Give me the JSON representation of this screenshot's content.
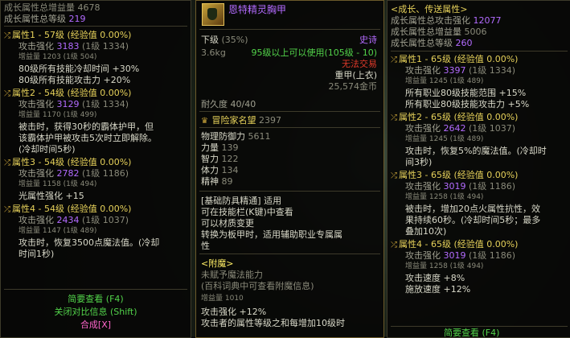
{
  "left": {
    "header": {
      "growth_total_label": "成长属性总增益量",
      "growth_total_value": "4678",
      "growth_level_label": "成长属性总等级",
      "growth_level_value": "219"
    },
    "attrs": [
      {
        "title": "属性1 - 57级 (经验值 0.00%)",
        "attack_label": "攻击强化",
        "attack_value": "3183",
        "attack_level": "(1级 1334)",
        "gain_label": "增益量",
        "gain_value": "1203 (1级 504)",
        "effects": [
          "80级所有技能冷却时间 +30%",
          "80级所有技能攻击力 +20%"
        ]
      },
      {
        "title": "属性2 - 54级 (经验值 0.00%)",
        "attack_label": "攻击强化",
        "attack_value": "3129",
        "attack_level": "(1级 1334)",
        "gain_label": "增益量",
        "gain_value": "1170 (1级 499)",
        "effects": [
          "被击时，获得30秒的霸体护甲，但",
          "该霸体护甲被攻击5次时立即解除。",
          "(冷却时间5秒)"
        ]
      },
      {
        "title": "属性3 - 54级 (经验值 0.00%)",
        "attack_label": "攻击强化",
        "attack_value": "2782",
        "attack_level": "(1级 1186)",
        "gain_label": "增益量",
        "gain_value": "1158 (1级 494)",
        "effects": [
          "光属性强化 +15"
        ]
      },
      {
        "title": "属性4 - 54级 (经验值 0.00%)",
        "attack_label": "攻击强化",
        "attack_value": "2434",
        "attack_level": "(1级 1037)",
        "gain_label": "增益量",
        "gain_value": "1147 (1级 489)",
        "effects": [
          "攻击时，恢复3500点魔法值。(冷却",
          "时间1秒)"
        ]
      }
    ],
    "buttons": {
      "view": "简要查看 (F4)",
      "compare": "关闭对比信息 (Shift)",
      "synth": "合成[X]"
    }
  },
  "mid": {
    "item_name": "恩特精灵胸甲",
    "grade": "下级",
    "grade_pct": "(35%)",
    "rarity": "史诗",
    "weight": "3.6kg",
    "use_req": "95级以上可以使用(105级 - 10)",
    "trade": "无法交易",
    "type": "重甲(上衣)",
    "price": "25,574金币",
    "durability": "耐久度 40/40",
    "fame_label": "冒险家名望",
    "fame_value": "2397",
    "stats": [
      {
        "label": "物理防御力",
        "value": "5611"
      },
      {
        "label": "力量",
        "value": "139"
      },
      {
        "label": "智力",
        "value": "122"
      },
      {
        "label": "体力",
        "value": "134"
      },
      {
        "label": "精神",
        "value": "89"
      }
    ],
    "mastery": [
      "[基础防具精通] 适用",
      "可在技能栏(K键)中查看",
      "可以材质变更",
      "转换为板甲时，适用辅助职业专属属",
      "性"
    ],
    "enchant_title": "<附魔>",
    "enchant_lines": [
      "未赋予魔法能力",
      "(百科词典中可查看附魔信息)"
    ],
    "gain_line": "增益量 1010",
    "bottom_lines": [
      "攻击强化 +12%",
      "攻击者的属性等级之和每增加10级时"
    ]
  },
  "right": {
    "header_title": "<成长、传送属性>",
    "header_rows": [
      {
        "label": "成长属性总攻击强化",
        "value": "12077"
      },
      {
        "label": "成长属性总增益量",
        "value": "5006"
      },
      {
        "label": "成长属性总等级",
        "value": "260"
      }
    ],
    "attrs": [
      {
        "title": "属性1 - 65级 (经验值 0.00%)",
        "attack_label": "攻击强化",
        "attack_value": "3397",
        "attack_level": "(1级 1334)",
        "gain_label": "增益量",
        "gain_value": "1245 (1级 489)",
        "effects": [
          "所有职业80级技能范围 +15%",
          "所有职业80级技能攻击力 +5%"
        ]
      },
      {
        "title": "属性2 - 65级 (经验值 0.00%)",
        "attack_label": "攻击强化",
        "attack_value": "2642",
        "attack_level": "(1级 1037)",
        "gain_label": "增益量",
        "gain_value": "1245 (1级 489)",
        "effects": [
          "攻击时，恢复5%的魔法值。(冷却时",
          "间3秒)"
        ]
      },
      {
        "title": "属性3 - 65级 (经验值 0.00%)",
        "attack_label": "攻击强化",
        "attack_value": "3019",
        "attack_level": "(1级 1186)",
        "gain_label": "增益量",
        "gain_value": "1258 (1级 494)",
        "effects": [
          "被击时，增加20点火属性抗性，效",
          "果持续60秒。(冷却时间5秒；最多",
          "叠加10次)"
        ]
      },
      {
        "title": "属性4 - 65级 (经验值 0.00%)",
        "attack_label": "攻击强化",
        "attack_value": "3019",
        "attack_level": "(1级 1186)",
        "gain_label": "增益量",
        "gain_value": "1258 (1级 494)",
        "effects": [
          "攻击速度 +8%",
          "施放速度 +12%"
        ]
      }
    ],
    "bottom_button": "简要查看 (F4)"
  },
  "colors": {
    "purple": "#b36bff",
    "yellow": "#e6d15a",
    "green": "#52d34a",
    "red": "#e03a2a",
    "pink": "#ff66cc"
  },
  "icons": {
    "attr_icon": "shuffle-icon",
    "fame_icon": "crown-icon",
    "item_icon": "chest-armor-icon"
  }
}
